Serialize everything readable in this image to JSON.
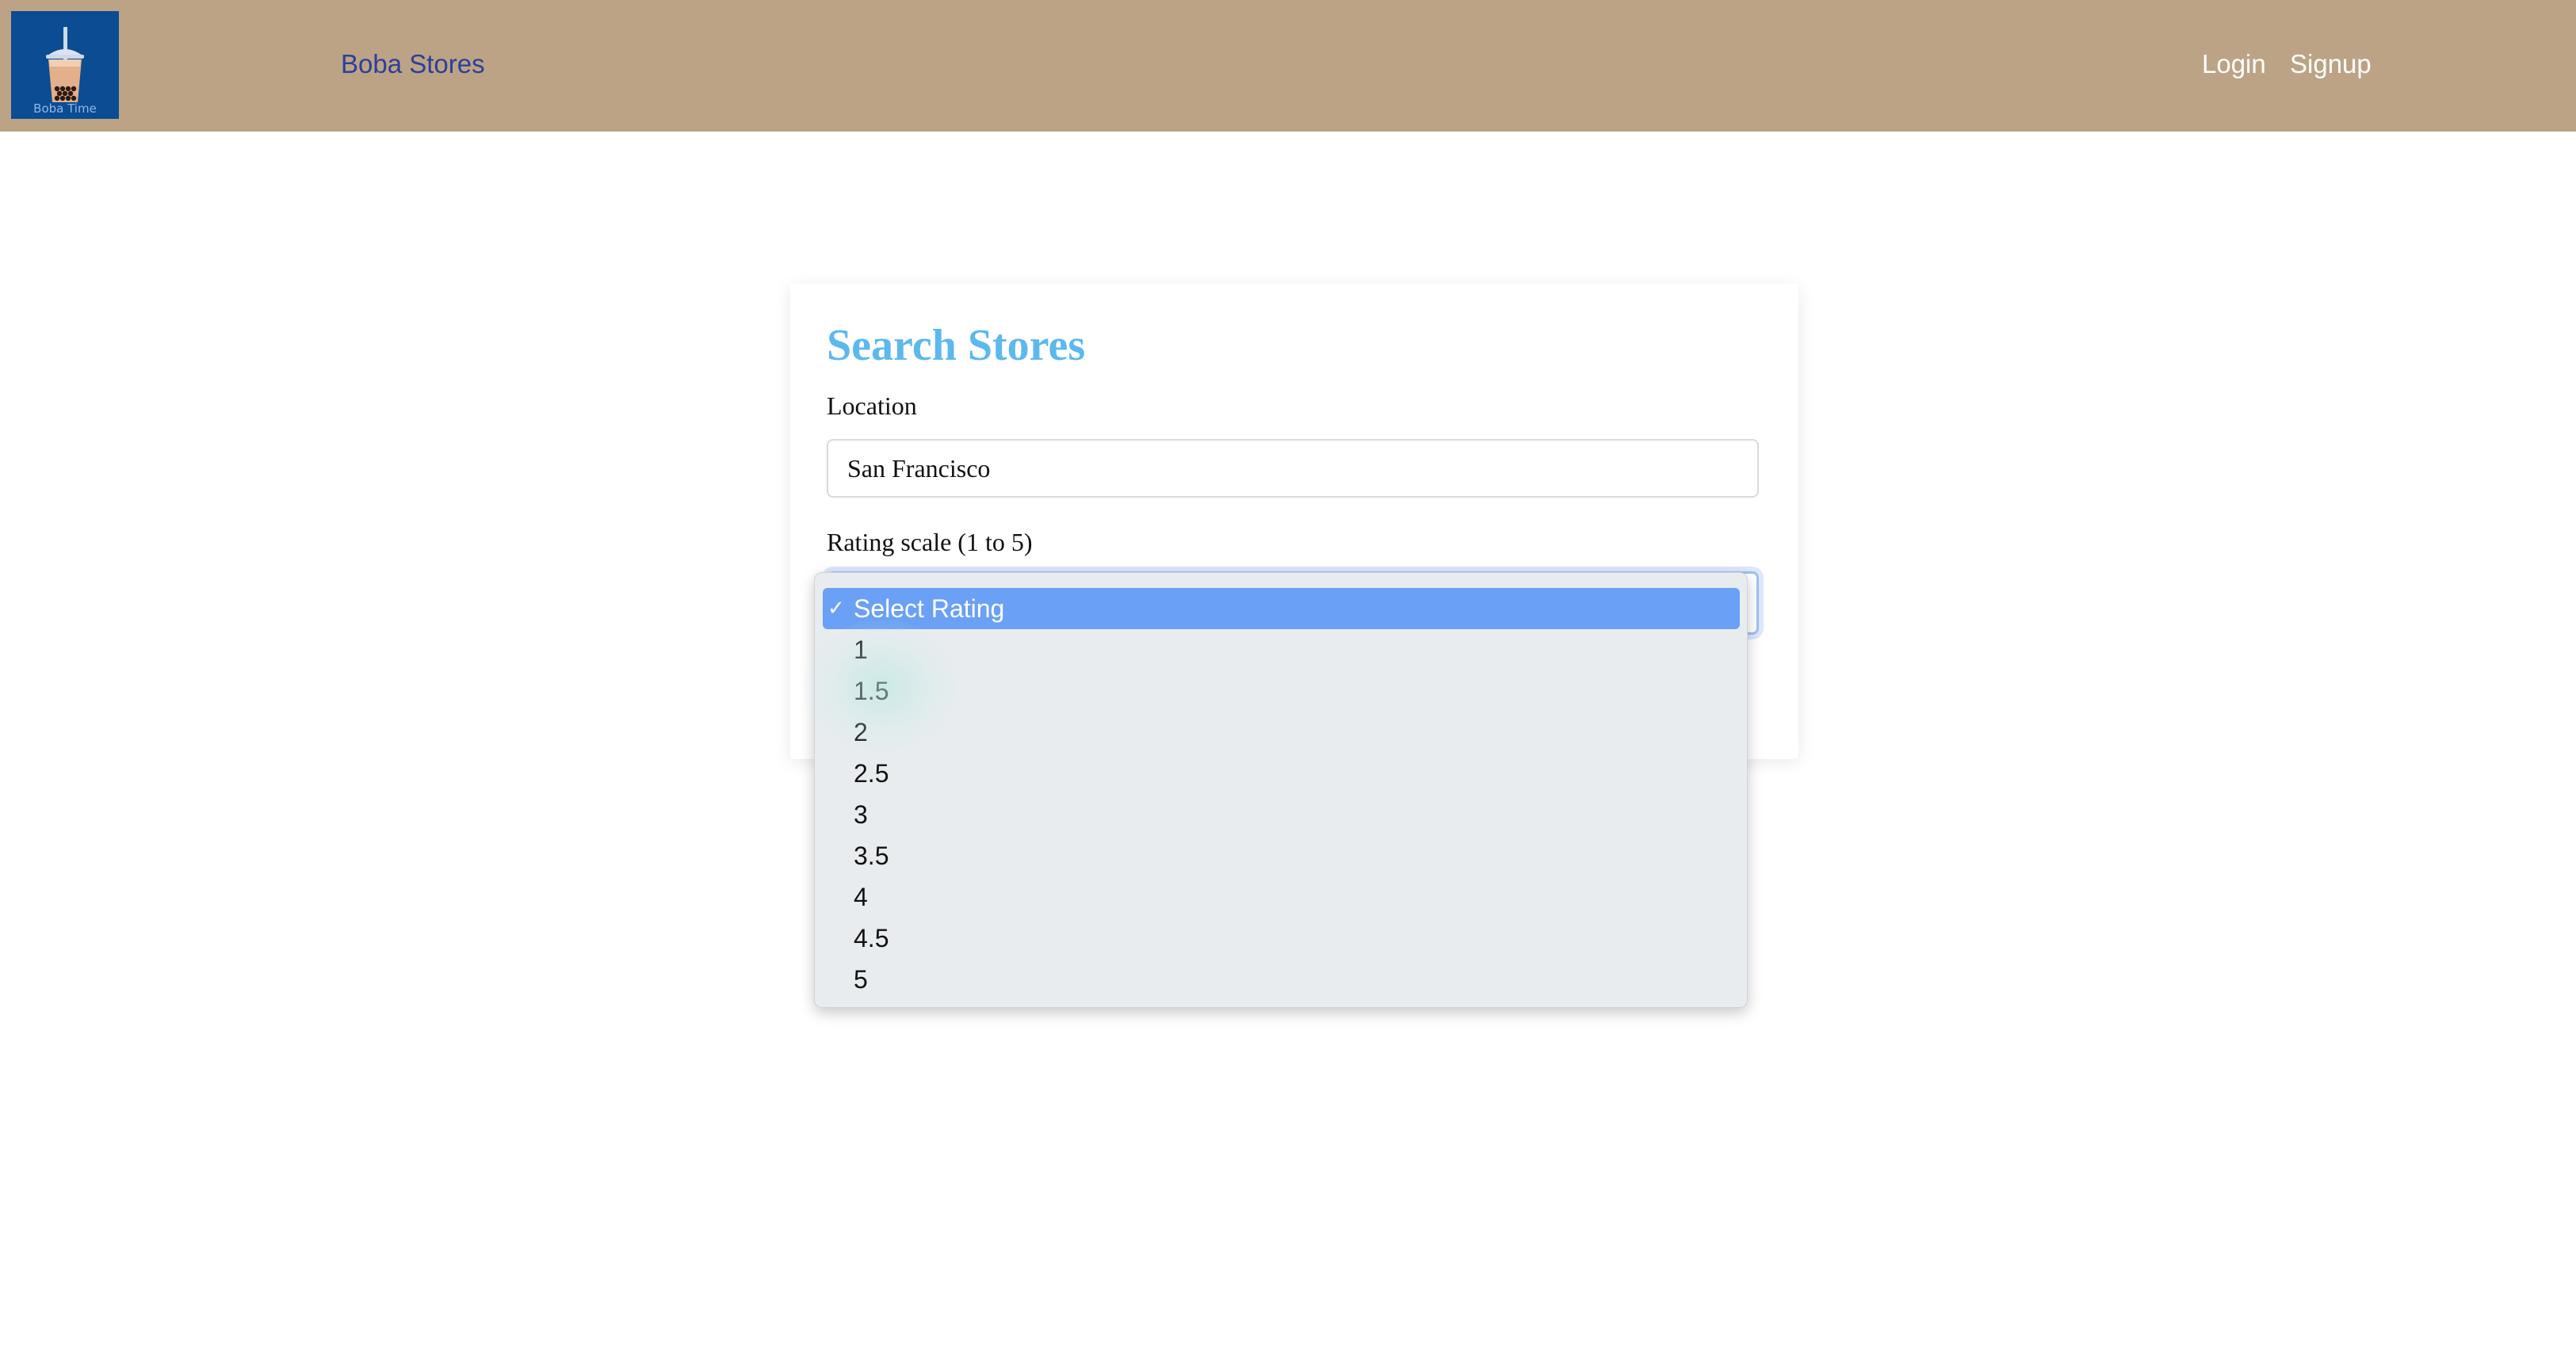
{
  "navbar": {
    "logo_text": "Boba Time",
    "brand": "Boba Stores",
    "login": "Login",
    "signup": "Signup",
    "background_color": "#bca385",
    "brand_color": "#2c3f9a"
  },
  "search_card": {
    "title": "Search Stores",
    "title_color": "#5db8ee",
    "location_label": "Location",
    "location_value": "San Francisco",
    "rating_label": "Rating scale (1 to 5)"
  },
  "rating_dropdown": {
    "selected_option": "Select Rating",
    "highlight_color": "#6aa0f5",
    "options": [
      "Select Rating",
      "1",
      "1.5",
      "2",
      "2.5",
      "3",
      "3.5",
      "4",
      "4.5",
      "5"
    ]
  },
  "icons": {
    "logo": "bubble-tea-cup-icon",
    "selected_marker": "checkmark-icon"
  }
}
